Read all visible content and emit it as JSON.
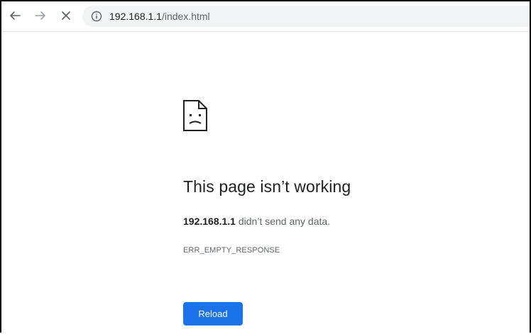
{
  "browser": {
    "url_host": "192.168.1.1",
    "url_path": "/index.html",
    "back_icon": "arrow-left-icon",
    "forward_icon": "arrow-right-icon",
    "stop_icon": "close-icon",
    "site_info_icon": "info-icon"
  },
  "error_page": {
    "icon": "sad-page-icon",
    "title": "This page isn’t working",
    "host": "192.168.1.1",
    "message": " didn’t send any data.",
    "error_code": "ERR_EMPTY_RESPONSE",
    "reload_label": "Reload"
  },
  "colors": {
    "accent": "#1a73e8",
    "heading": "#202124",
    "secondary_text": "#5f6368",
    "omnibox_bg": "#f1f3f4"
  }
}
